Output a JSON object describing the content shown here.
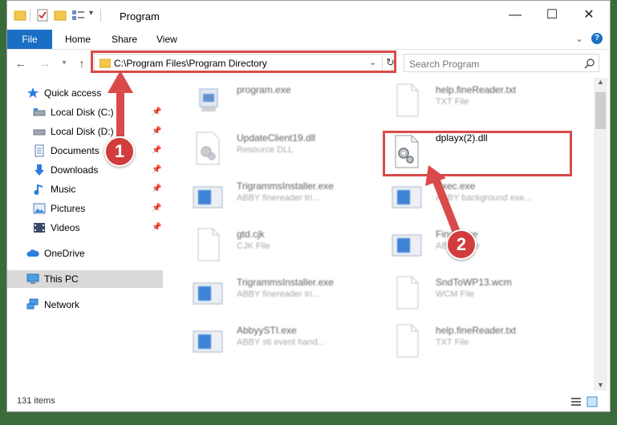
{
  "window": {
    "title": "Program",
    "controls": {
      "minimize": "—",
      "maximize": "☐",
      "close": "✕"
    }
  },
  "ribbon": {
    "tabs": [
      "File",
      "Home",
      "Share",
      "View"
    ]
  },
  "address": {
    "path": "C:\\Program Files\\Program Directory",
    "search_placeholder": "Search Program"
  },
  "navpane": {
    "items": [
      {
        "label": "Quick access",
        "icon": "star-icon",
        "pinned": false
      },
      {
        "label": "Local Disk (C:)",
        "icon": "drive-icon",
        "pinned": true
      },
      {
        "label": "Local Disk (D:)",
        "icon": "drive-icon",
        "pinned": true
      },
      {
        "label": "Documents",
        "icon": "documents-icon",
        "pinned": true
      },
      {
        "label": "Downloads",
        "icon": "download-icon",
        "pinned": true
      },
      {
        "label": "Music",
        "icon": "music-icon",
        "pinned": true
      },
      {
        "label": "Pictures",
        "icon": "pictures-icon",
        "pinned": true
      },
      {
        "label": "Videos",
        "icon": "videos-icon",
        "pinned": true
      },
      {
        "label": "OneDrive",
        "icon": "cloud-icon",
        "pinned": false
      },
      {
        "label": "This PC",
        "icon": "computer-icon",
        "pinned": false
      },
      {
        "label": "Network",
        "icon": "network-icon",
        "pinned": false
      }
    ]
  },
  "files": {
    "left": [
      {
        "name": "program.exe",
        "type": "",
        "icon": "installer-icon"
      },
      {
        "name": "UpdateClient19.dll",
        "type": "Resource DLL",
        "icon": "dll-icon"
      },
      {
        "name": "TrigrammsInstaller.exe",
        "type": "ABBY finereader tri...",
        "icon": "app-icon"
      },
      {
        "name": "gtd.cjk",
        "type": "CJK File",
        "icon": "blank-file-icon"
      },
      {
        "name": "TrigrammsInstaller.exe",
        "type": "ABBY finereader tri...",
        "icon": "app-icon"
      },
      {
        "name": "AbbyySTI.exe",
        "type": "ABBY sti event hand...",
        "icon": "app-icon"
      }
    ],
    "right": [
      {
        "name": "help.fineReader.txt",
        "type": "TXT File",
        "icon": "blank-file-icon"
      },
      {
        "name": "dplayx(2).dll",
        "type": "",
        "icon": "dll-icon"
      },
      {
        "name": "Exec.exe",
        "type": "ABBY background exe...",
        "icon": "app-icon"
      },
      {
        "name": "Fine...exe",
        "type": "ABBY...exe",
        "icon": "app-icon"
      },
      {
        "name": "SndToWP13.wcm",
        "type": "WCM File",
        "icon": "blank-file-icon"
      },
      {
        "name": "help.fineReader.txt",
        "type": "TXT File",
        "icon": "blank-file-icon"
      }
    ]
  },
  "status": {
    "count": "131 items"
  },
  "annotations": {
    "step1": "1",
    "step2": "2",
    "color": "#d94a4a"
  }
}
